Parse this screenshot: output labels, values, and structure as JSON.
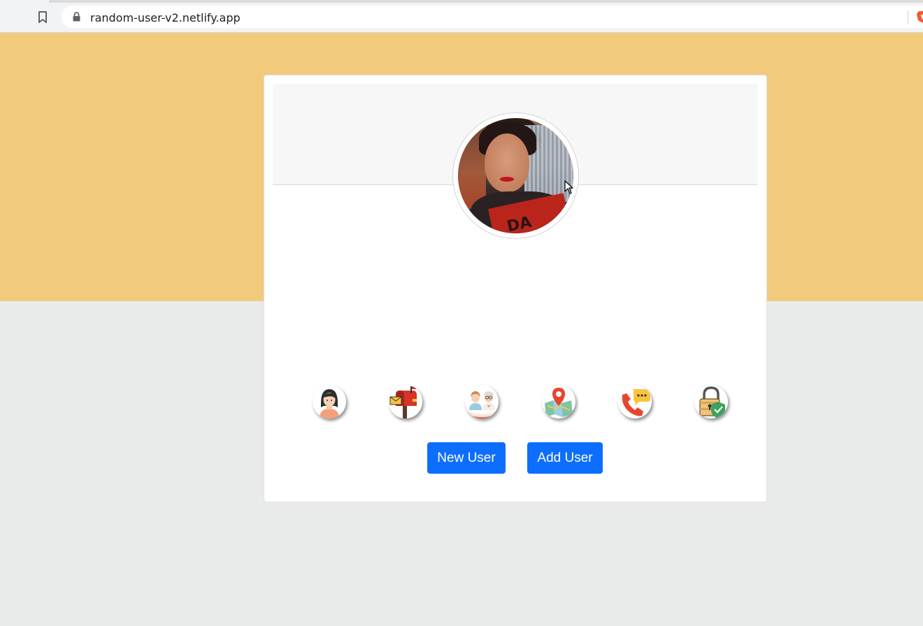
{
  "browser": {
    "url": "random-user-v2.netlify.app",
    "bookmark_icon": "bookmark-icon",
    "lock_icon": "lock-icon",
    "extension_icon": "brave-lion-icon"
  },
  "page": {
    "accent_color": "#f1ca7c",
    "background_color": "#e9eaea",
    "button_color": "#0d6efd"
  },
  "card": {
    "avatar": "user-photo",
    "info_icons": [
      {
        "name": "person-icon"
      },
      {
        "name": "mailbox-icon"
      },
      {
        "name": "couple-icon"
      },
      {
        "name": "map-icon"
      },
      {
        "name": "phone-icon"
      },
      {
        "name": "lock-icon"
      }
    ],
    "buttons": {
      "new_user": "New User",
      "add_user": "Add User"
    }
  }
}
